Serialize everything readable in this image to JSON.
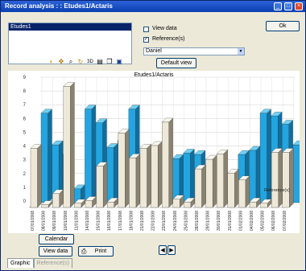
{
  "window": {
    "title": "Record analysis : : Etudes1/Actaris"
  },
  "title_buttons": [
    "_",
    "□",
    "×"
  ],
  "list": {
    "items": [
      "Etudes1"
    ]
  },
  "view_data_checkbox": {
    "label": "View data",
    "checked": false
  },
  "reference_checkbox": {
    "label": "Reference(s)",
    "checked": true
  },
  "reference_select": {
    "value": "Daniel"
  },
  "buttons": {
    "ok": "Ok",
    "default_view": "Default view",
    "calendar": "Calendar",
    "view_data": "View data",
    "print": "Print"
  },
  "toolbar_icons": [
    "palette-icon",
    "move-icon",
    "zoom-icon",
    "rotate-icon",
    "3d-icon",
    "print-icon",
    "copy-icon",
    "save-icon"
  ],
  "tabs": [
    "Graphic",
    "Reference(s)"
  ],
  "colors": {
    "series_a": "#22a5e0",
    "series_b": "#eee8d8"
  },
  "chart_data": {
    "type": "bar",
    "title": "Etudes1/Actaris",
    "y_ticks": [
      "0",
      "1",
      "2",
      "3",
      "4",
      "5",
      "6",
      "7",
      "8",
      "9"
    ],
    "ylim": [
      0,
      9
    ],
    "z_label": "Reference(s)",
    "categories": [
      "07/01/2008",
      "08/01/2008",
      "09/01/2008",
      "10/01/2008",
      "11/01/2008",
      "14/01/2008",
      "15/01/2008",
      "16/01/2008",
      "17/01/2008",
      "18/01/2008",
      "21/01/2008",
      "22/01/2008",
      "23/01/2008",
      "24/01/2008",
      "25/01/2008",
      "28/01/2008",
      "29/01/2008",
      "30/01/2008",
      "31/01/2008",
      "01/02/2008",
      "04/02/2008",
      "05/02/2008",
      "06/02/2008",
      "07/02/2008"
    ],
    "series": [
      {
        "values": [
          6.5,
          4.2,
          3.5,
          1.0,
          6.8,
          5.8,
          4.0,
          4.5,
          6.8,
          0.2,
          2.8,
          3.5,
          3.2,
          3.6,
          3.5,
          0.2,
          0.2,
          0.3,
          3.5,
          3.8,
          6.5,
          6.3,
          5.7,
          4.2
        ]
      },
      {
        "values": [
          4.3,
          0.2,
          1.0,
          8.8,
          0.3,
          0.5,
          3.0,
          0.4,
          5.4,
          3.6,
          4.3,
          4.5,
          6.2,
          0.6,
          0.4,
          2.8,
          3.5,
          3.9,
          2.5,
          2.0,
          0.4,
          0.3,
          4.0,
          4.0
        ]
      }
    ]
  }
}
